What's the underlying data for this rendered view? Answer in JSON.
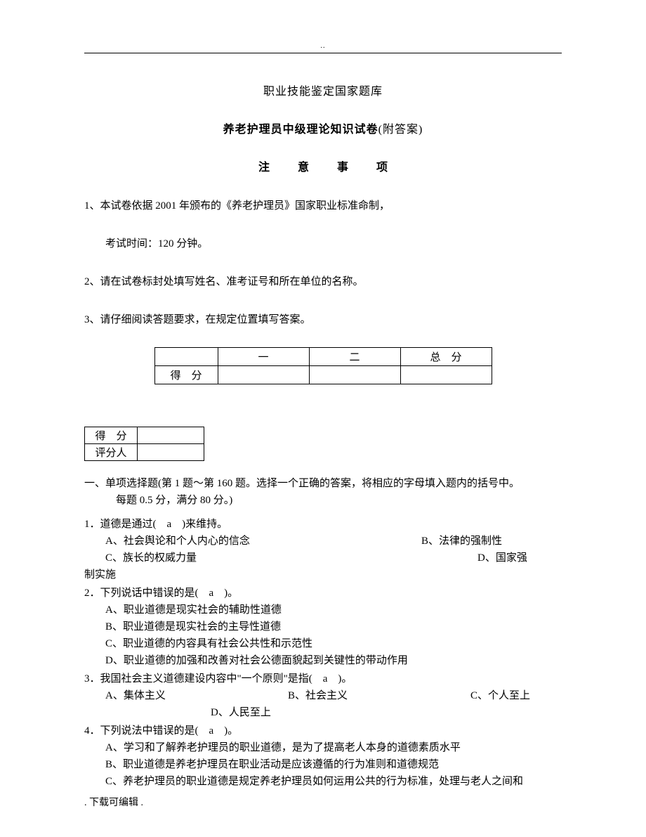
{
  "header_dots": "..",
  "title_line1": "职业技能鉴定国家题库",
  "title_line2_main": "养老护理员中级理论知识试卷",
  "title_line2_paren": "(附答案)",
  "notice_chars": [
    "注",
    "意",
    "事",
    "项"
  ],
  "instructions": {
    "i1": "1、本试卷依据 2001 年颁布的《养老护理员》国家职业标准命制，",
    "i1b": "考试时间：120 分钟。",
    "i2": "2、请在试卷标封处填写姓名、准考证号和所在单位的名称。",
    "i3": "3、请仔细阅读答题要求，在规定位置填写答案。"
  },
  "score_table_main": {
    "row1": [
      "",
      "一",
      "二",
      "总　分"
    ],
    "row2_label": "得　分"
  },
  "score_table_small": {
    "r1": "得　分",
    "r2": "评分人"
  },
  "section1": {
    "head": "一、单项选择题(第 1 题～第 160 题。选择一个正确的答案，将相应的字母填入题内的括号中。",
    "sub": "每题 0.5 分，满分 80 分。)"
  },
  "q1": {
    "stem": "1．道德是通过(　a　)来维持。",
    "A": "A、社会舆论和个人内心的信念",
    "B": "B、法律的强制性",
    "C": "C、族长的权威力量",
    "D": "D、国家强",
    "tail": "制实施"
  },
  "q2": {
    "stem": "2．下列说话中错误的是(　a　)。",
    "A": "A、职业道德是现实社会的辅助性道德",
    "B": "B、职业道德是现实社会的主导性道德",
    "C": "C、职业道德的内容具有社会公共性和示范性",
    "D": "D、职业道德的加强和改善对社会公德面貌起到关键性的带动作用"
  },
  "q3": {
    "stem": "3．我国社会主义道德建设内容中\"一个原则\"是指(　a　)。",
    "A": "A、集体主义",
    "B": "B、社会主义",
    "C": "C、个人至上",
    "D": "D、人民至上"
  },
  "q4": {
    "stem": "4．下列说法中错误的是(　a　)。",
    "A": "A、学习和了解养老护理员的职业道德，是为了提高老人本身的道德素质水平",
    "B": "B、职业道德是养老护理员在职业活动是应该遵循的行为准则和道德规范",
    "C": "C、养老护理员的职业道德是规定养老护理员如何运用公共的行为标准，处理与老人之间和"
  },
  "footer": ". 下载可编辑 ."
}
